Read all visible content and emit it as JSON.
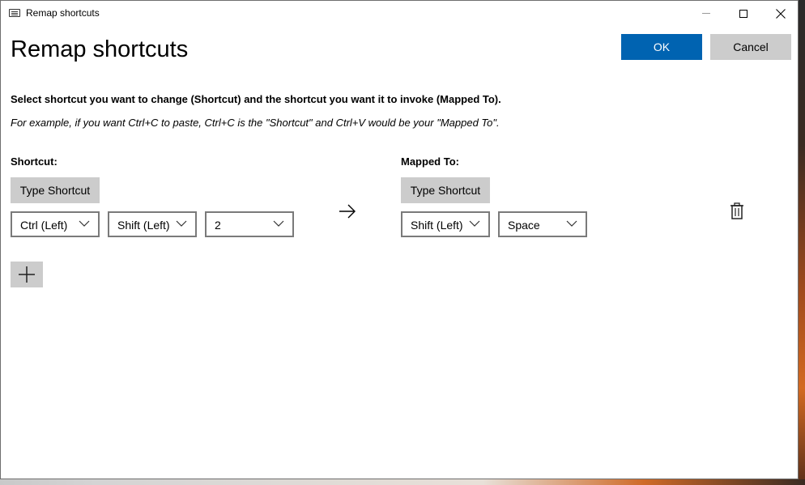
{
  "window": {
    "title": "Remap shortcuts",
    "controls": {
      "minimize_icon": "minimize-icon",
      "maximize_icon": "maximize-icon",
      "close_icon": "close-icon"
    }
  },
  "header": {
    "title": "Remap shortcuts",
    "ok_label": "OK",
    "cancel_label": "Cancel"
  },
  "instructions": {
    "main": "Select shortcut you want to change (Shortcut) and the shortcut you want it to invoke (Mapped To).",
    "example": "For example, if you want Ctrl+C to paste, Ctrl+C is the \"Shortcut\" and Ctrl+V would be your \"Mapped To\"."
  },
  "shortcut": {
    "label": "Shortcut:",
    "type_button": "Type Shortcut",
    "keys": [
      "Ctrl (Left)",
      "Shift (Left)",
      "2"
    ]
  },
  "mapped_to": {
    "label": "Mapped To:",
    "type_button": "Type Shortcut",
    "keys": [
      "Shift (Left)",
      "Space"
    ]
  },
  "icons": {
    "arrow": "arrow-right-icon",
    "delete": "trash-icon",
    "add": "plus-icon",
    "dropdown": "chevron-down-icon"
  },
  "colors": {
    "accent": "#0063b1",
    "button_gray": "#cccccc"
  }
}
